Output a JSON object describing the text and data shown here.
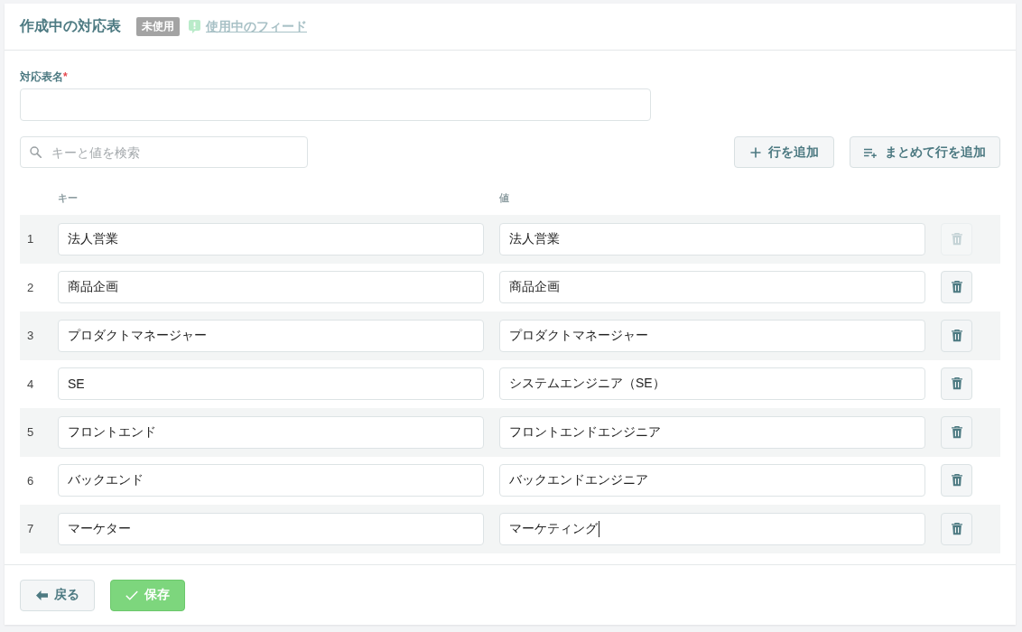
{
  "header": {
    "title": "作成中の対応表",
    "status_badge": "未使用",
    "feed_link": {
      "label": "使用中のフィード",
      "disabled": true
    }
  },
  "name_field": {
    "label": "対応表名",
    "required_mark": "*"
  },
  "search": {
    "placeholder": "キーと値を検索"
  },
  "toolbar": [
    {
      "kind": "add-row",
      "label": "行を追加"
    },
    {
      "kind": "bulk-add",
      "label": "まとめて行を追加"
    }
  ],
  "table": {
    "columns": [
      "キー",
      "値"
    ],
    "rows": [
      {
        "number": "1",
        "key": "法人営業",
        "value": "法人営業",
        "value_focused": false,
        "delete_disabled": true
      },
      {
        "number": "2",
        "key": "商品企画",
        "value": "商品企画",
        "value_focused": false,
        "delete_disabled": false
      },
      {
        "number": "3",
        "key": "プロダクトマネージャー",
        "value": "プロダクトマネージャー",
        "value_focused": false,
        "delete_disabled": false
      },
      {
        "number": "4",
        "key": "SE",
        "value": "システムエンジニア（SE）",
        "value_focused": false,
        "delete_disabled": false
      },
      {
        "number": "5",
        "key": "フロントエンド",
        "value": "フロントエンドエンジニア",
        "value_focused": false,
        "delete_disabled": false
      },
      {
        "number": "6",
        "key": "バックエンド",
        "value": "バックエンドエンジニア",
        "value_focused": false,
        "delete_disabled": false
      },
      {
        "number": "7",
        "key": "マーケター",
        "value": "マーケティング",
        "value_focused": true,
        "delete_disabled": false
      }
    ]
  },
  "footer": {
    "buttons": [
      {
        "kind": "back",
        "label": "戻る"
      },
      {
        "kind": "save",
        "label": "保存"
      }
    ]
  }
}
